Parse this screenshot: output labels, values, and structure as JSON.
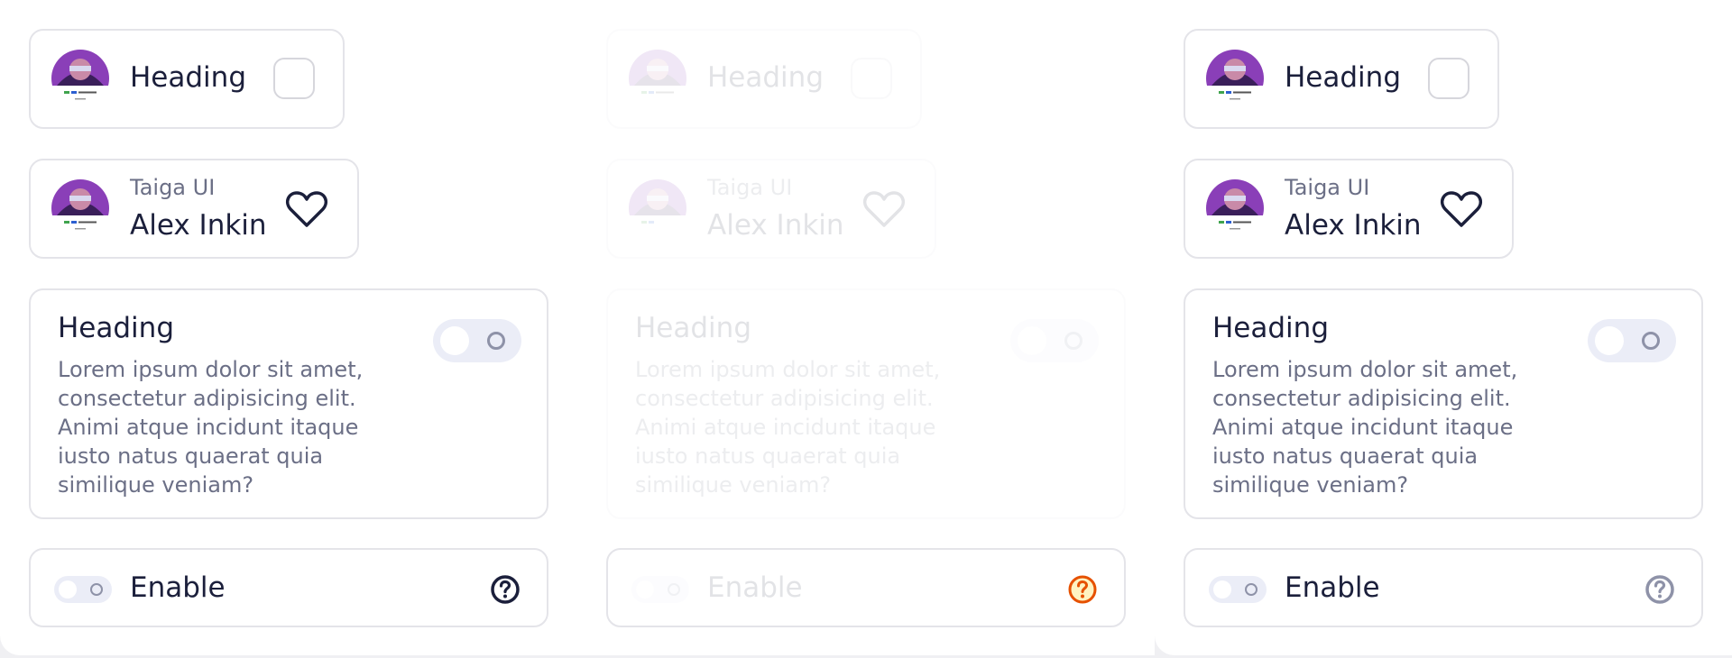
{
  "columns": [
    {
      "state": "normal",
      "heading_card": {
        "title": "Heading"
      },
      "user_card": {
        "company": "Taiga UI",
        "name": "Alex Inkin"
      },
      "description_card": {
        "title": "Heading",
        "body": "Lorem ipsum dolor sit amet, consectetur adipisicing elit. Animi atque incidunt itaque iusto natus quaerat quia similique veniam?"
      },
      "enable_card": {
        "label": "Enable",
        "help_icon": "help-circle-icon",
        "help_icon_color": "#1b1f3b"
      }
    },
    {
      "state": "disabled",
      "heading_card": {
        "title": "Heading"
      },
      "user_card": {
        "company": "Taiga UI",
        "name": "Alex Inkin"
      },
      "description_card": {
        "title": "Heading",
        "body": "Lorem ipsum dolor sit amet, consectetur adipisicing elit. Animi atque incidunt itaque iusto natus quaerat quia similique veniam?"
      },
      "enable_card": {
        "label": "Enable",
        "help_icon": "help-circle-icon",
        "help_icon_color": "#e65100"
      }
    },
    {
      "state": "normal",
      "heading_card": {
        "title": "Heading"
      },
      "user_card": {
        "company": "Taiga UI",
        "name": "Alex Inkin"
      },
      "description_card": {
        "title": "Heading",
        "body": "Lorem ipsum dolor sit amet, consectetur adipisicing elit. Animi atque incidunt itaque iusto natus quaerat quia similique veniam?"
      },
      "enable_card": {
        "label": "Enable",
        "help_icon": "help-circle-icon",
        "help_icon_color": "#8e92a8"
      }
    }
  ],
  "icons": {
    "avatar": "avatar-photo",
    "heart": "heart-icon",
    "help": "help-circle-icon"
  }
}
